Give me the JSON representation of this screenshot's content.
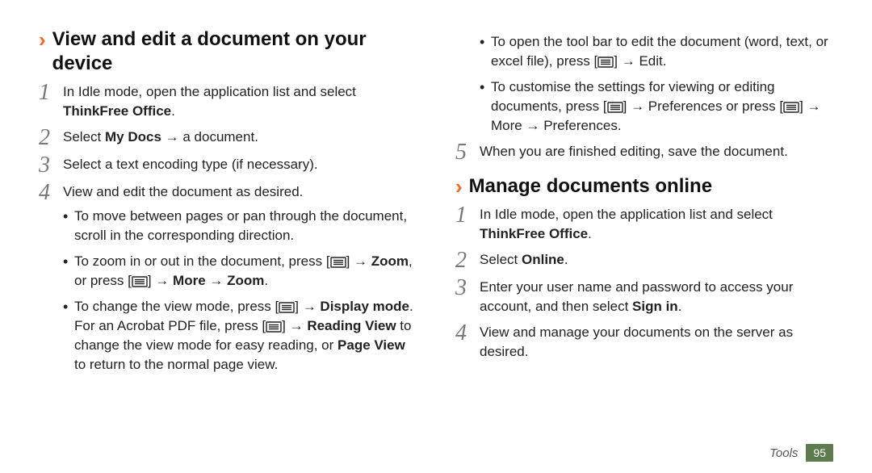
{
  "footer": {
    "section": "Tools",
    "page": "95"
  },
  "icons": {
    "menu": "menu-icon"
  },
  "left": {
    "heading": "View and edit a document on your device",
    "steps": [
      {
        "num": "1",
        "pre": "In Idle mode, open the application list and select ",
        "bold": "ThinkFree Office",
        "post": "."
      },
      {
        "num": "2",
        "pre": "Select ",
        "bold": "My Docs",
        "post": " → a document."
      },
      {
        "num": "3",
        "pre": "Select a text encoding type (if necessary)."
      },
      {
        "num": "4",
        "pre": "View and edit the document as desired."
      }
    ],
    "sub4": [
      {
        "text": "To move between pages or pan through the document, scroll in the corresponding direction."
      },
      {
        "pre": "To zoom in or out in the document, press [",
        "icon1": true,
        "mid1": "] → ",
        "bold1": "Zoom",
        "mid2": ", or press [",
        "icon2": true,
        "mid3": "] → ",
        "bold2": "More",
        "mid4": " → ",
        "bold3": "Zoom",
        "post": "."
      },
      {
        "pre": "To change the view mode, press [",
        "icon1": true,
        "mid1": "] → ",
        "bold1": "Display mode",
        "mid2": ". For an Acrobat PDF file, press [",
        "icon2": true,
        "mid3": "] → ",
        "bold2": "Reading View",
        "mid4": " to change the view mode for easy reading, or ",
        "bold3": "Page View",
        "post": " to return to the normal page view."
      }
    ]
  },
  "right": {
    "cont": [
      {
        "pre": "To open the tool bar to edit the document (word, text, or excel file), press [",
        "icon1": true,
        "mid1": "] → ",
        "bold1": "Edit",
        "post": "."
      },
      {
        "pre": "To customise the settings for viewing or editing documents, press [",
        "icon1": true,
        "mid1": "] → ",
        "bold1": "Preferences",
        "mid2": " or press [",
        "icon2": true,
        "mid3": "] → ",
        "bold2": "More",
        "mid4": " → ",
        "bold3": "Preferences",
        "post": "."
      }
    ],
    "step5": {
      "num": "5",
      "pre": "When you are finished editing, save the document."
    },
    "heading2": "Manage documents online",
    "steps2": [
      {
        "num": "1",
        "pre": "In Idle mode, open the application list and select ",
        "bold": "ThinkFree Office",
        "post": "."
      },
      {
        "num": "2",
        "pre": "Select ",
        "bold": "Online",
        "post": "."
      },
      {
        "num": "3",
        "pre": "Enter your user name and password to access your account, and then select ",
        "bold": "Sign in",
        "post": "."
      },
      {
        "num": "4",
        "pre": "View and manage your documents on the server as desired."
      }
    ]
  }
}
